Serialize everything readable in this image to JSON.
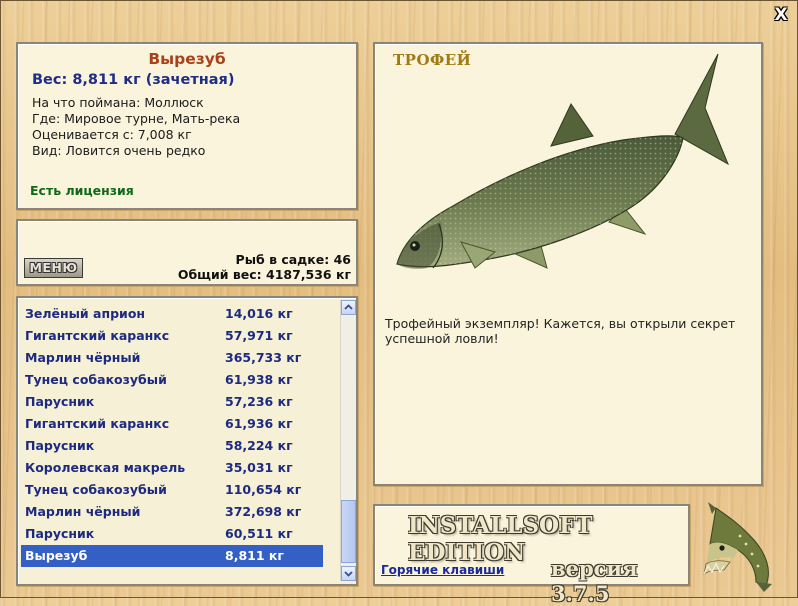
{
  "window": {
    "close_label": "X"
  },
  "fish": {
    "name": "Вырезуб",
    "weight_line": "Вес: 8,811 кг (зачетная)",
    "caught_on": "На что поймана: Моллюск",
    "location": "Где: Мировое турне, Мать-река",
    "valued_from": "Оценивается с: 7,008 кг",
    "rarity": "Вид: Ловится очень редко",
    "license": "Есть лицензия"
  },
  "stats": {
    "menu_label": "МЕНЮ",
    "fish_count": "Рыб в садке: 46",
    "total_weight": "Общий вес: 4187,536 кг"
  },
  "catch_list": [
    {
      "name": "Зелёный априон",
      "weight": "14,016 кг"
    },
    {
      "name": "Гигантский каранкс",
      "weight": "57,971 кг"
    },
    {
      "name": "Марлин чёрный",
      "weight": "365,733 кг"
    },
    {
      "name": "Тунец собакозубый",
      "weight": "61,938 кг"
    },
    {
      "name": "Парусник",
      "weight": "57,236 кг"
    },
    {
      "name": "Гигантский каранкс",
      "weight": "61,936 кг"
    },
    {
      "name": "Парусник",
      "weight": "58,224 кг"
    },
    {
      "name": "Королевская макрель",
      "weight": "35,031 кг"
    },
    {
      "name": "Тунец собакозубый",
      "weight": "110,654 кг"
    },
    {
      "name": "Марлин чёрный",
      "weight": "372,698 кг"
    },
    {
      "name": "Парусник",
      "weight": "60,511 кг"
    },
    {
      "name": "Вырезуб",
      "weight": "8,811 кг",
      "selected": true
    }
  ],
  "trophy": {
    "title": "ТРОФЕЙ",
    "description": "Трофейный экземпляр! Кажется, вы открыли секрет успешной ловли!",
    "image_icon": "fish-illustration"
  },
  "footer": {
    "edition": "INSTALLSOFT EDITION",
    "hotkeys_link": "Горячие клавиши",
    "version": "версия 3.7.5",
    "logo_icon": "pike-fish-icon"
  },
  "colors": {
    "accent_name": "#a8421a",
    "weight_blue": "#1e2e86",
    "license_green": "#0f6a17",
    "selection": "#3460c6"
  }
}
